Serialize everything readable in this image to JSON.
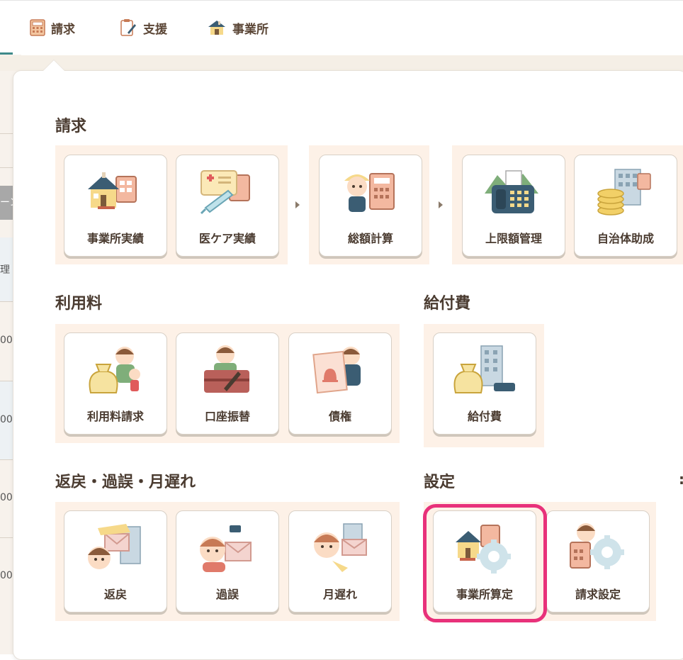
{
  "nav": {
    "items": [
      {
        "label": "請求",
        "icon": "calculator-icon"
      },
      {
        "label": "支援",
        "icon": "clipboard-pen-icon"
      },
      {
        "label": "事業所",
        "icon": "house-icon"
      }
    ]
  },
  "background": {
    "partial_texts": [
      "ーン",
      "理",
      "00",
      "00",
      "00",
      "00"
    ]
  },
  "sections": {
    "billing": {
      "title": "請求",
      "cards": [
        "事業所実績",
        "医ケア実績",
        "総額計算",
        "上限額管理",
        "自治体助成"
      ]
    },
    "usage_fee": {
      "title": "利用料",
      "cards": [
        "利用料請求",
        "口座振替",
        "債権"
      ]
    },
    "benefit": {
      "title": "給付費",
      "cards": [
        "給付費"
      ]
    },
    "returns": {
      "title": "返戻・過誤・月遅れ",
      "cards": [
        "返戻",
        "過誤",
        "月遅れ"
      ]
    },
    "settings": {
      "title": "設定",
      "cards": [
        "事業所算定",
        "請求設定"
      ],
      "highlighted": "事業所算定"
    }
  },
  "colors": {
    "accent_teal": "#3f8a8a",
    "group_bg": "#fdf1e7",
    "highlight": "#e8317a",
    "text": "#4a3b30"
  }
}
